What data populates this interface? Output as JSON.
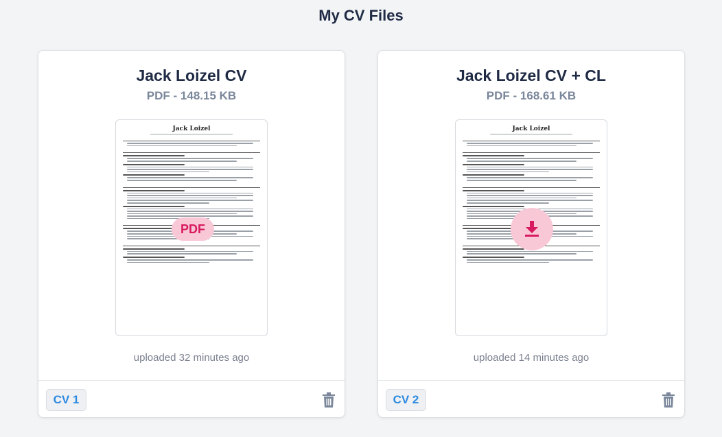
{
  "page": {
    "title": "My CV Files"
  },
  "cards": [
    {
      "title": "Jack Loizel CV",
      "meta": "PDF - 148.15 KB",
      "badge": "PDF",
      "uploaded": "uploaded 32 minutes ago",
      "tag": "CV 1",
      "doc": {
        "name": "Jack Loizel"
      }
    },
    {
      "title": "Jack Loizel CV + CL",
      "meta": "PDF - 168.61 KB",
      "badge_icon": "download-icon",
      "uploaded": "uploaded 14 minutes ago",
      "tag": "CV 2",
      "doc": {
        "name": "Jack Loizel"
      }
    }
  ],
  "colors": {
    "accent": "#2b8ae0",
    "badge_bg": "#f9c8d6",
    "badge_fg": "#d81b60",
    "title": "#1f2a44"
  }
}
